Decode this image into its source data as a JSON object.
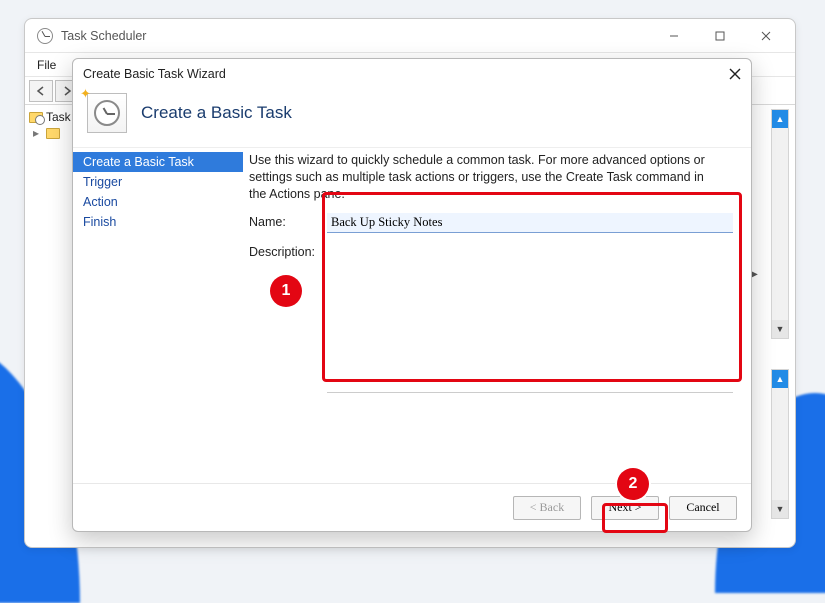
{
  "app": {
    "title": "Task Scheduler",
    "menu": {
      "file": "File"
    },
    "tree": {
      "root": "Task"
    }
  },
  "wizard": {
    "title": "Create Basic Task Wizard",
    "heading": "Create a Basic Task",
    "steps": {
      "create": "Create a Basic Task",
      "trigger": "Trigger",
      "action": "Action",
      "finish": "Finish"
    },
    "intro": "Use this wizard to quickly schedule a common task.  For more advanced options or settings such as multiple task actions or triggers, use the Create Task command in the Actions pane.",
    "labels": {
      "name": "Name:",
      "description": "Description:"
    },
    "fields": {
      "name": "Back Up Sticky Notes",
      "description": ""
    },
    "buttons": {
      "back": "< Back",
      "next": "Next >",
      "cancel": "Cancel"
    }
  },
  "annotations": {
    "step1": "1",
    "step2": "2"
  }
}
